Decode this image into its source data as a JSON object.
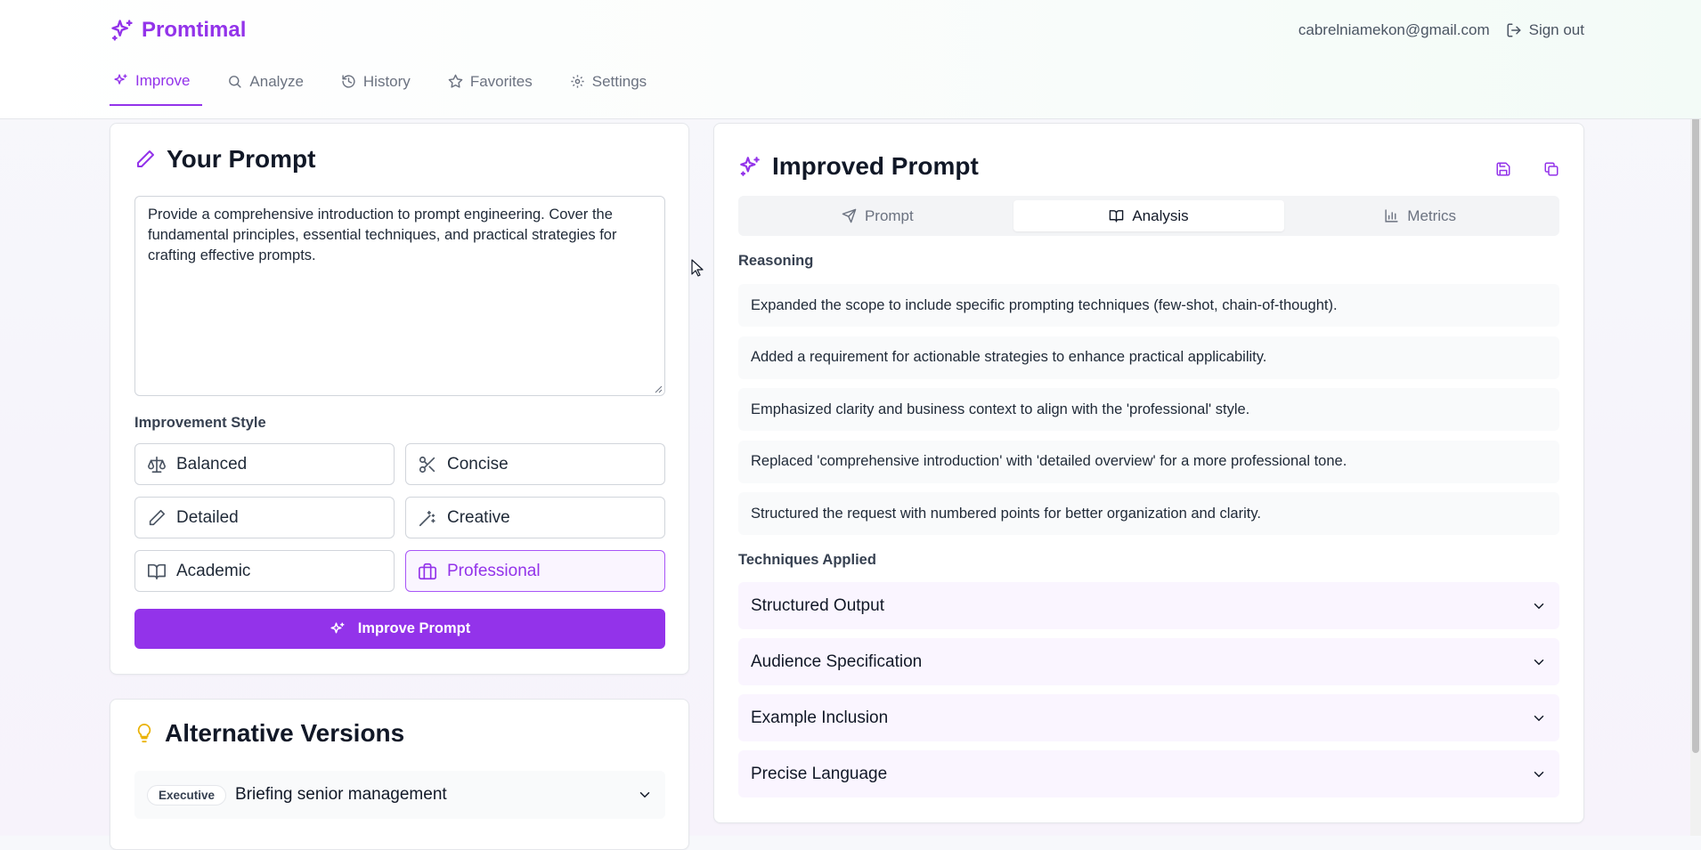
{
  "app": {
    "name": "Promtimal",
    "accent_color": "#9333ea"
  },
  "header": {
    "email": "cabrelniamekon@gmail.com",
    "signout_label": "Sign out"
  },
  "nav": {
    "items": [
      {
        "label": "Improve",
        "icon": "sparkles-icon",
        "active": true
      },
      {
        "label": "Analyze",
        "icon": "search-icon"
      },
      {
        "label": "History",
        "icon": "history-icon"
      },
      {
        "label": "Favorites",
        "icon": "star-icon"
      },
      {
        "label": "Settings",
        "icon": "gear-icon"
      }
    ]
  },
  "prompt_card": {
    "title": "Your Prompt",
    "prompt_text": "Provide a comprehensive introduction to prompt engineering. Cover the fundamental principles, essential techniques, and practical strategies for crafting effective prompts.",
    "style_label": "Improvement Style",
    "styles": [
      {
        "label": "Balanced",
        "icon": "scale-icon"
      },
      {
        "label": "Concise",
        "icon": "scissors-icon"
      },
      {
        "label": "Detailed",
        "icon": "pencil-icon"
      },
      {
        "label": "Creative",
        "icon": "magic-wand-icon"
      },
      {
        "label": "Academic",
        "icon": "book-open-icon"
      },
      {
        "label": "Professional",
        "icon": "briefcase-icon",
        "selected": true
      }
    ],
    "improve_button": "Improve Prompt"
  },
  "alternatives": {
    "title": "Alternative Versions",
    "items": [
      {
        "badge": "Executive",
        "title": "Briefing senior management"
      }
    ]
  },
  "improved": {
    "title": "Improved Prompt",
    "tabs": [
      {
        "label": "Prompt",
        "icon": "send-icon"
      },
      {
        "label": "Analysis",
        "icon": "book-open-icon",
        "active": true
      },
      {
        "label": "Metrics",
        "icon": "bar-chart-icon"
      }
    ],
    "reasoning_label": "Reasoning",
    "reasons": [
      "Expanded the scope to include specific prompting techniques (few-shot, chain-of-thought).",
      "Added a requirement for actionable strategies to enhance practical applicability.",
      "Emphasized clarity and business context to align with the 'professional' style.",
      "Replaced 'comprehensive introduction' with 'detailed overview' for a more professional tone.",
      "Structured the request with numbered points for better organization and clarity."
    ],
    "techniques_label": "Techniques Applied",
    "techniques": [
      "Structured Output",
      "Audience Specification",
      "Example Inclusion",
      "Precise Language"
    ]
  }
}
